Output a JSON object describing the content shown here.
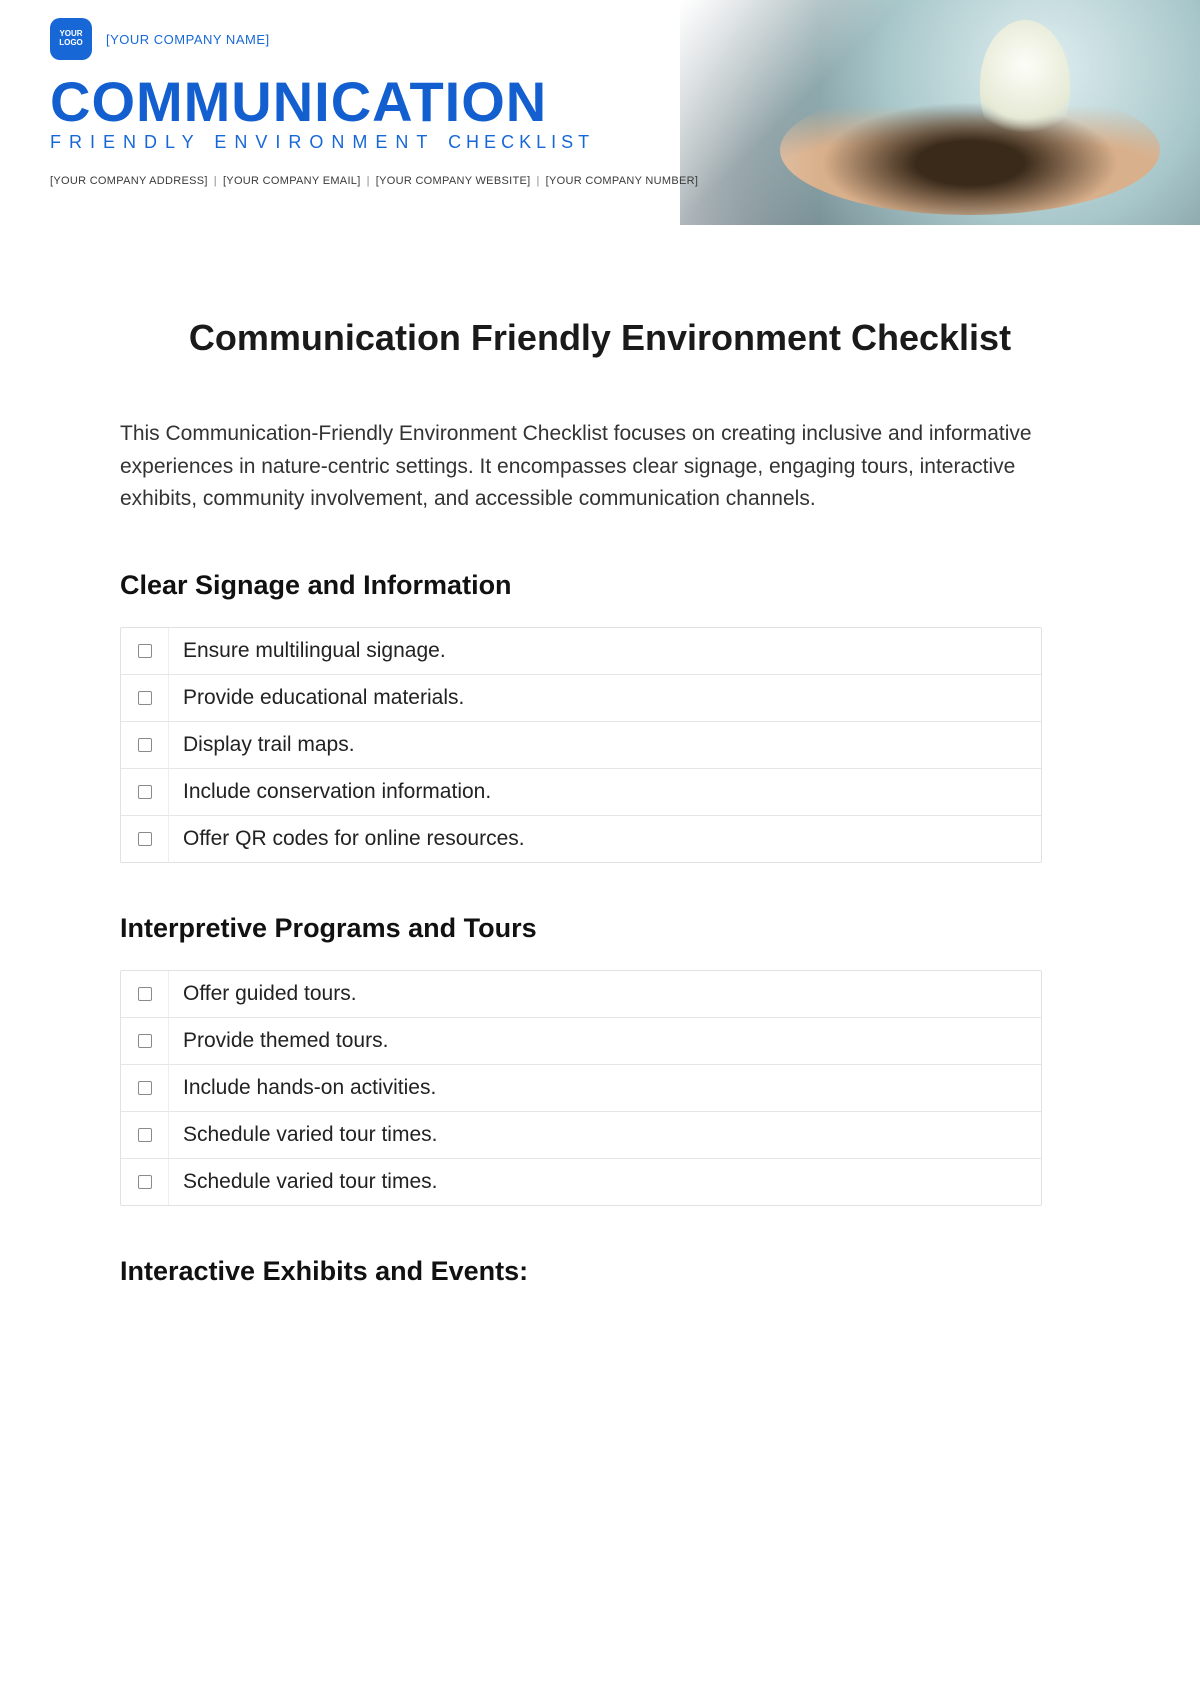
{
  "banner": {
    "logo_text": "YOUR LOGO",
    "company_name": "[YOUR COMPANY NAME]",
    "title_word": "COMMUNICATION",
    "subtitle_a": "FRIENDLY ENVIRONMENT",
    "subtitle_b": "CHECKLIST",
    "meta": {
      "address": "[YOUR COMPANY ADDRESS]",
      "email": "[YOUR COMPANY EMAIL]",
      "website": "[YOUR COMPANY WEBSITE]",
      "number": "[YOUR COMPANY NUMBER]"
    }
  },
  "doc_title": "Communication Friendly Environment Checklist",
  "intro": "This Communication-Friendly Environment Checklist focuses on creating inclusive and informative experiences in nature-centric settings. It encompasses clear signage, engaging tours, interactive exhibits, community involvement, and accessible communication channels.",
  "sections": [
    {
      "heading": "Clear Signage and Information",
      "items": [
        "Ensure multilingual signage.",
        "Provide educational materials.",
        "Display trail maps.",
        "Include conservation information.",
        "Offer QR codes for online resources."
      ]
    },
    {
      "heading": "Interpretive Programs and Tours",
      "items": [
        "Offer guided tours.",
        "Provide themed tours.",
        "Include hands-on activities.",
        "Schedule varied tour times.",
        "Schedule varied tour times."
      ]
    },
    {
      "heading": "Interactive Exhibits and Events:",
      "items": []
    }
  ]
}
